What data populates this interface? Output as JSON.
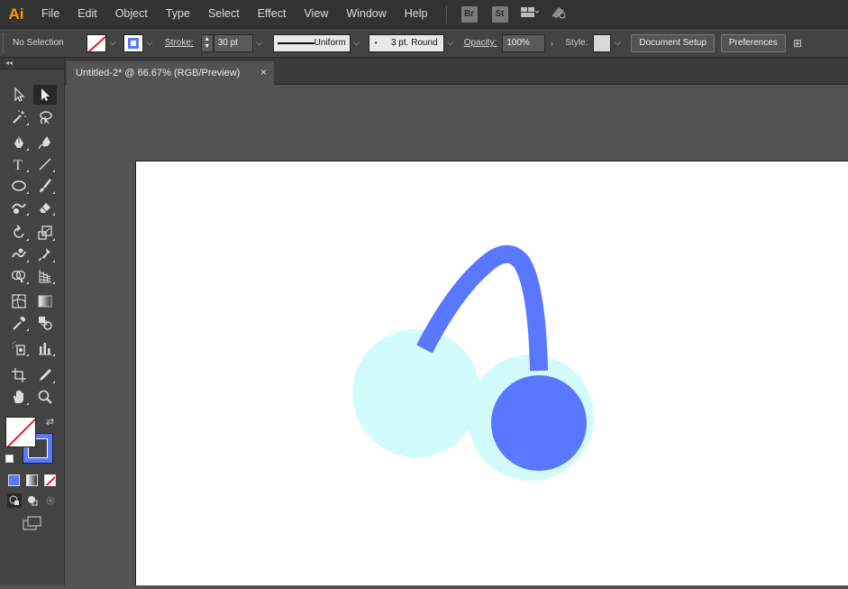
{
  "app": {
    "logo": "Ai"
  },
  "menu": [
    "File",
    "Edit",
    "Object",
    "Type",
    "Select",
    "Effect",
    "View",
    "Window",
    "Help"
  ],
  "menubar_apps": [
    "Br",
    "St"
  ],
  "control": {
    "selection_label": "No Selection",
    "stroke_label": "Stroke:",
    "stroke_value": "30 pt",
    "profile_label": "Uniform",
    "brush_label": "3 pt. Round",
    "opacity_label": "Opacity:",
    "opacity_value": "100%",
    "style_label": "Style:",
    "document_setup": "Document Setup",
    "preferences": "Preferences"
  },
  "document_tab": {
    "title": "Untitled-2* @ 66.67% (RGB/Preview)",
    "close": "×"
  },
  "colors": {
    "stroke_blue": "#5a78ff",
    "cherry_light": "#d2fbfb",
    "cherry_dark": "#5a78ff",
    "accent_orange": "#ff9a00"
  },
  "tools": [
    "selection-tool",
    "direct-selection-tool",
    "magic-wand-tool",
    "lasso-tool",
    "pen-tool",
    "curvature-tool",
    "type-tool",
    "line-segment-tool",
    "ellipse-tool",
    "paintbrush-tool",
    "shaper-tool",
    "eraser-tool",
    "rotate-tool",
    "scale-tool",
    "warp-tool",
    "puppet-warp-tool",
    "shape-builder-tool",
    "perspective-grid-tool",
    "mesh-tool",
    "gradient-tool",
    "eyedropper-tool",
    "blend-tool",
    "symbol-sprayer-tool",
    "column-graph-tool",
    "artboard-tool",
    "slice-tool",
    "hand-tool",
    "zoom-tool"
  ]
}
